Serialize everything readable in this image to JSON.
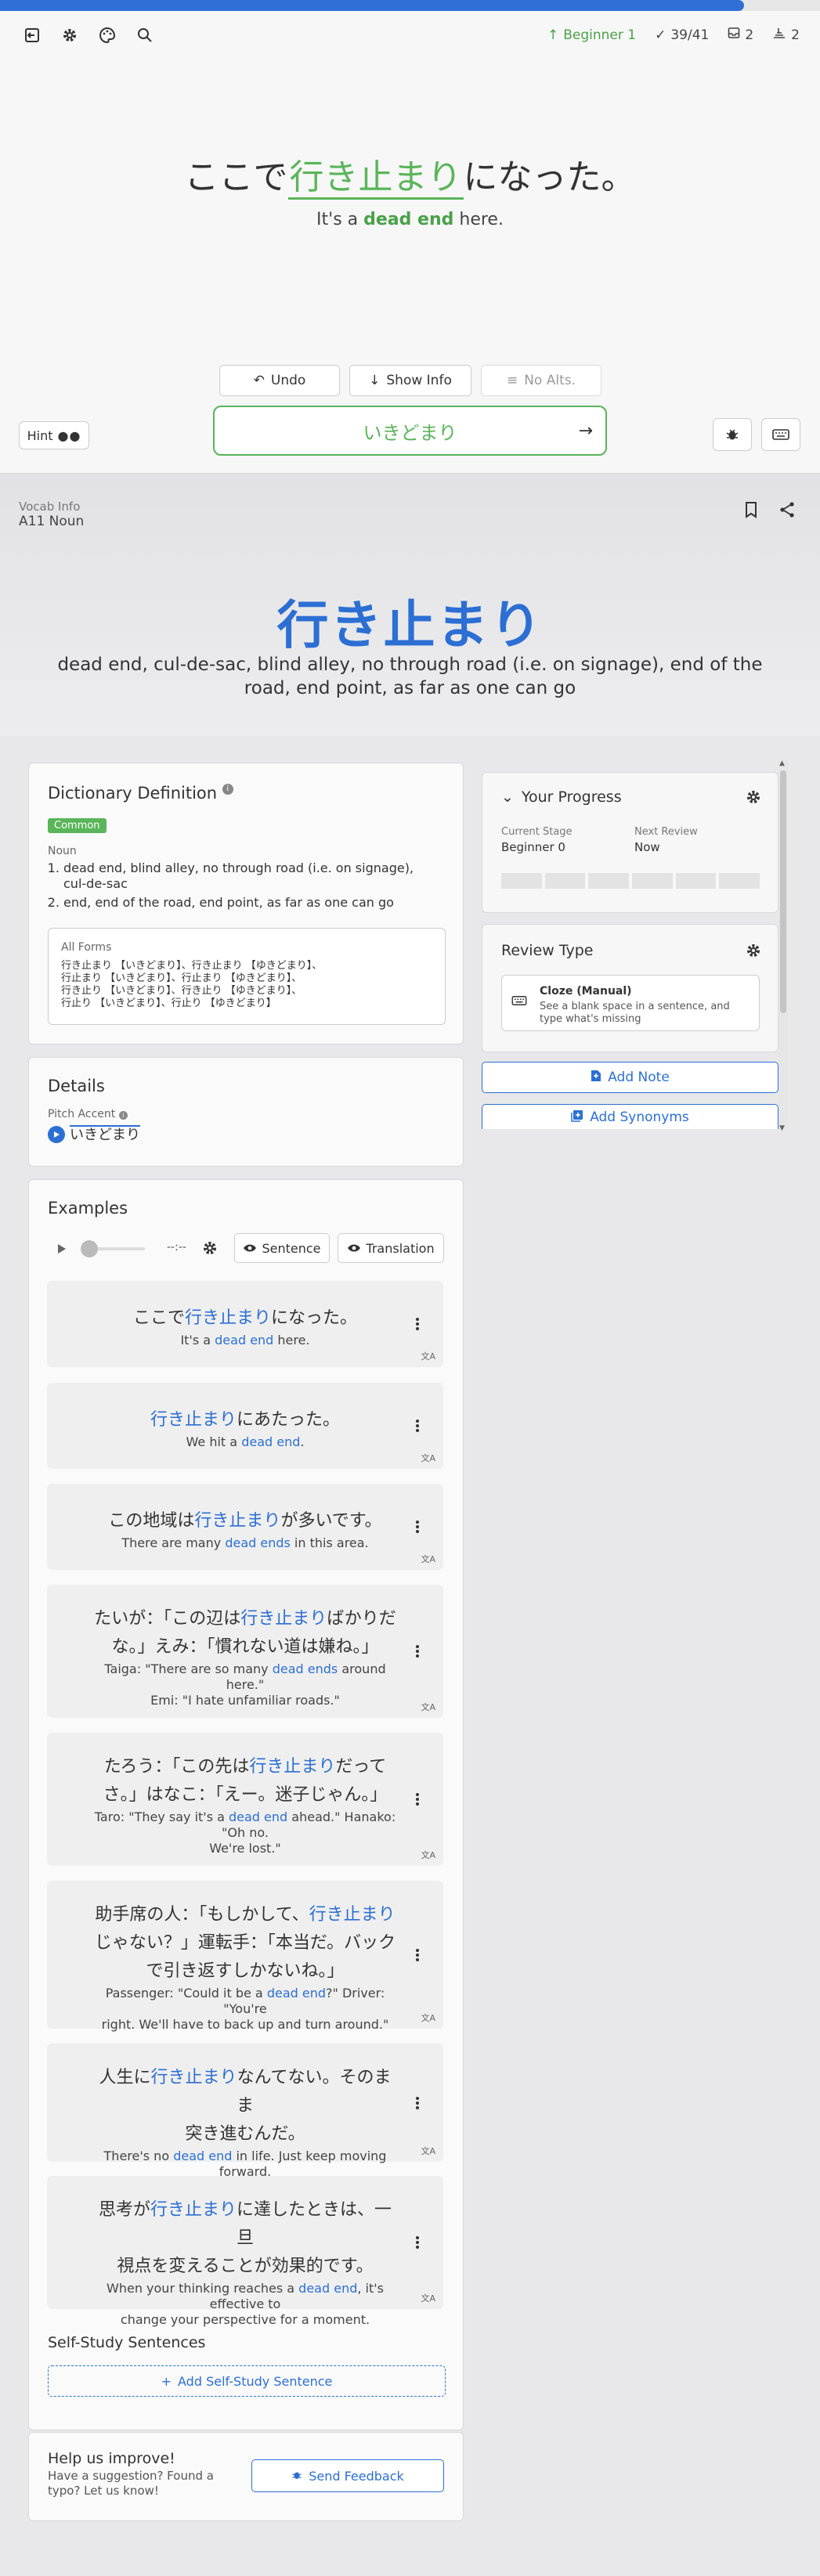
{
  "header": {
    "progress_fraction": 0.907,
    "level": "Beginner 1",
    "reviews": "39/41",
    "inbox": "2",
    "queue": "2"
  },
  "review": {
    "sentence_before": "ここで",
    "sentence_target": "行き止まり",
    "sentence_after": "になった。",
    "translation_before": "It's a ",
    "translation_target": "dead end",
    "translation_after": " here.",
    "undo_label": "Undo",
    "show_info_label": "Show Info",
    "no_alts_label": "No Alts.",
    "hint_label": "Hint",
    "answer_value": "いきどまり"
  },
  "vocab": {
    "info_label": "Vocab Info",
    "type": "A11 Noun",
    "word": "行き止まり",
    "meaning": "dead end, cul-de-sac, blind alley, no through road (i.e. on signage), end of the road, end point, as far as one can go"
  },
  "dictionary": {
    "title": "Dictionary Definition",
    "badge": "Common",
    "pos": "Noun",
    "definitions": [
      "dead end, blind alley, no through road (i.e. on signage), cul-de-sac",
      "end, end of the road, end point, as far as one can go"
    ],
    "all_forms_label": "All Forms",
    "all_forms_lines": [
      "行き止まり 【いきどまり】、行き止まり 【ゆきどまり】、",
      "行止まり 【いきどまり】、行止まり 【ゆきどまり】、",
      "行き止り 【いきどまり】、行き止り 【ゆきどまり】、",
      "行止り 【いきどまり】、行止り 【ゆきどまり】"
    ]
  },
  "details": {
    "title": "Details",
    "pitch_label": "Pitch Accent",
    "pitch_reading": "いきどまり"
  },
  "examples": {
    "title": "Examples",
    "time": "--:--",
    "sentence_btn": "Sentence",
    "translation_btn": "Translation",
    "items": [
      {
        "jp1": [
          "ここで",
          "行き止まり",
          "になった。"
        ],
        "en1": [
          "It's a ",
          "dead end",
          " here."
        ]
      },
      {
        "jp1": [
          "",
          "行き止まり",
          "にあたった。"
        ],
        "en1": [
          "We hit a ",
          "dead end",
          "."
        ]
      },
      {
        "jp1": [
          "この地域は",
          "行き止まり",
          "が多いです。"
        ],
        "en1": [
          "There are many ",
          "dead ends",
          " in this area."
        ]
      },
      {
        "jp1": [
          "たいが：「この辺は",
          "行き止まり",
          "ばかりだ"
        ],
        "jp2": "な。」えみ：「慣れない道は嫌ね。」",
        "en1": [
          "Taiga: \"There are so many ",
          "dead ends",
          " around here.\""
        ],
        "en2": "Emi: \"I hate unfamiliar roads.\""
      },
      {
        "jp1": [
          "たろう：「この先は",
          "行き止まり",
          "だって"
        ],
        "jp2": "さ。」はなこ：「えー。迷子じゃん。」",
        "en1": [
          "Taro: \"They say it's a ",
          "dead end",
          " ahead.\" Hanako: \"Oh no."
        ],
        "en2": "We're lost.\""
      },
      {
        "jp1": [
          "助手席の人：「もしかして、",
          "行き止まり",
          ""
        ],
        "jp2": "じゃない？」運転手：「本当だ。バック",
        "jp3": "で引き返すしかないね。」",
        "en1": [
          "Passenger: \"Could it be a ",
          "dead end",
          "?\" Driver: \"You're"
        ],
        "en2": "right. We'll have to back up and turn around.\""
      },
      {
        "jp1": [
          "人生に",
          "行き止まり",
          "なんてない。そのまま"
        ],
        "jp2": "突き進むんだ。",
        "en1": [
          "There's no ",
          "dead end",
          " in life. Just keep moving forward."
        ]
      },
      {
        "jp1": [
          "思考が",
          "行き止まり",
          "に達したときは、一旦"
        ],
        "jp2": "視点を変えることが効果的です。",
        "en1": [
          "When your thinking reaches a ",
          "dead end",
          ", it's effective to"
        ],
        "en2": "change your perspective for a moment."
      }
    ],
    "self_study_title": "Self-Study Sentences",
    "add_self_study": "Add Self-Study Sentence"
  },
  "feedback": {
    "title": "Help us improve!",
    "text1": "Have a suggestion? Found a",
    "text2": "typo? Let us know!",
    "button": "Send Feedback"
  },
  "progress_panel": {
    "title": "Your Progress",
    "stage_label": "Current Stage",
    "stage_value": "Beginner 0",
    "next_label": "Next Review",
    "next_value": "Now"
  },
  "review_type": {
    "title": "Review Type",
    "name": "Cloze (Manual)",
    "desc1": "See a blank space in a sentence, and",
    "desc2": "type what's missing"
  },
  "right_buttons": {
    "add_note": "Add Note",
    "add_synonyms": "Add Synonyms"
  },
  "colors": {
    "accent_blue": "#2c6fd4",
    "accent_green": "#5ab55a"
  }
}
